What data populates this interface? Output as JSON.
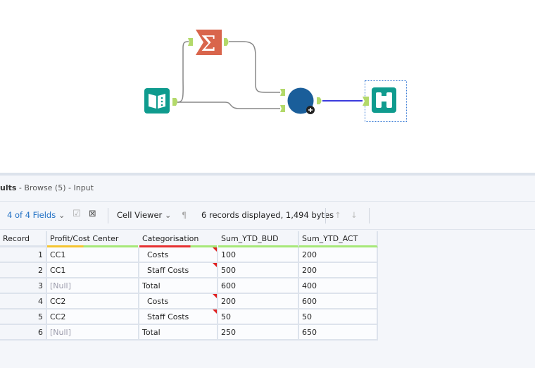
{
  "results": {
    "title": "ults",
    "subtitle": " - Browse (5) - Input"
  },
  "toolbar": {
    "fields_label": "4 of 4 Fields",
    "cell_viewer_label": "Cell Viewer",
    "records_info": "6 records displayed, 1,494 bytes"
  },
  "table": {
    "columns": [
      "Record",
      "Profit/Cost Center",
      "Categorisation",
      "Sum_YTD_BUD",
      "Sum_YTD_ACT"
    ],
    "rows": [
      [
        "1",
        "CC1",
        "  Costs",
        "100",
        "200"
      ],
      [
        "2",
        "CC1",
        "  Staff Costs",
        "500",
        "200"
      ],
      [
        "3",
        "[Null]",
        "Total",
        "600",
        "400"
      ],
      [
        "4",
        "CC2",
        "  Costs",
        "200",
        "600"
      ],
      [
        "5",
        "CC2",
        "  Staff Costs",
        "50",
        "50"
      ],
      [
        "6",
        "[Null]",
        "Total",
        "250",
        "650"
      ]
    ]
  },
  "colors": {
    "input_tool": "#0f9b8e",
    "summarize_tool": "#d9654c",
    "union_tool": "#1a5e9a",
    "browse_tool": "#0f9b8e",
    "anchor": "#b3d96a",
    "selected_wire": "#3b3bdd"
  }
}
